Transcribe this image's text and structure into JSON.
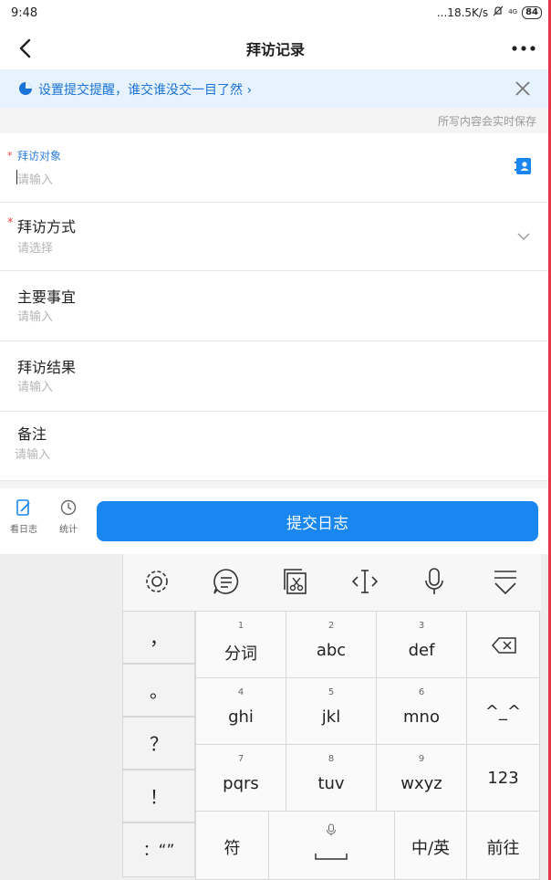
{
  "status_bar": {
    "time": "9:48",
    "network_speed": "...18.5K/s",
    "signal": "4G",
    "battery": "84"
  },
  "nav": {
    "title": "拜访记录",
    "back_icon": "chevron-left-icon",
    "more_icon": "more-dots-icon"
  },
  "banner": {
    "text": "设置提交提醒，谁交谁没交一目了然 ›",
    "color": "#1a73d6"
  },
  "autosave_text": "所写内容会实时保存",
  "form": {
    "visit_target": {
      "label": "拜访对象",
      "placeholder": "请输入",
      "required": "*"
    },
    "visit_method": {
      "label": "拜访方式",
      "placeholder": "请选择",
      "required": "*"
    },
    "main_matters": {
      "label": "主要事宜",
      "placeholder": "请输入"
    },
    "visit_result": {
      "label": "拜访结果",
      "placeholder": "请输入"
    },
    "remarks": {
      "label": "备注",
      "placeholder": "请输入"
    }
  },
  "bottom_bar": {
    "tabs": [
      {
        "label": "看日志",
        "icon": "log-icon"
      },
      {
        "label": "统计",
        "icon": "clock-icon"
      }
    ],
    "submit_label": "提交日志",
    "accent": "#1a87f0"
  },
  "keyboard": {
    "toolbar_icons": [
      "gear-icon",
      "chat-icon",
      "clipboard-icon",
      "cursor-move-icon",
      "mic-icon",
      "hide-keyboard-icon"
    ],
    "punctuation": [
      "，",
      "。",
      "？",
      "！",
      "：“”"
    ],
    "keys": [
      {
        "num": "1",
        "label": "分词"
      },
      {
        "num": "2",
        "label": "abc"
      },
      {
        "num": "3",
        "label": "def"
      },
      {
        "num": "4",
        "label": "ghi"
      },
      {
        "num": "5",
        "label": "jkl"
      },
      {
        "num": "6",
        "label": "mno"
      },
      {
        "num": "7",
        "label": "pqrs"
      },
      {
        "num": "8",
        "label": "tuv"
      },
      {
        "num": "9",
        "label": "wxyz"
      }
    ],
    "emoticon": "^_^",
    "num_key": "123",
    "symbol_key": "符",
    "lang_key": "中/英",
    "enter_key": "前往"
  }
}
